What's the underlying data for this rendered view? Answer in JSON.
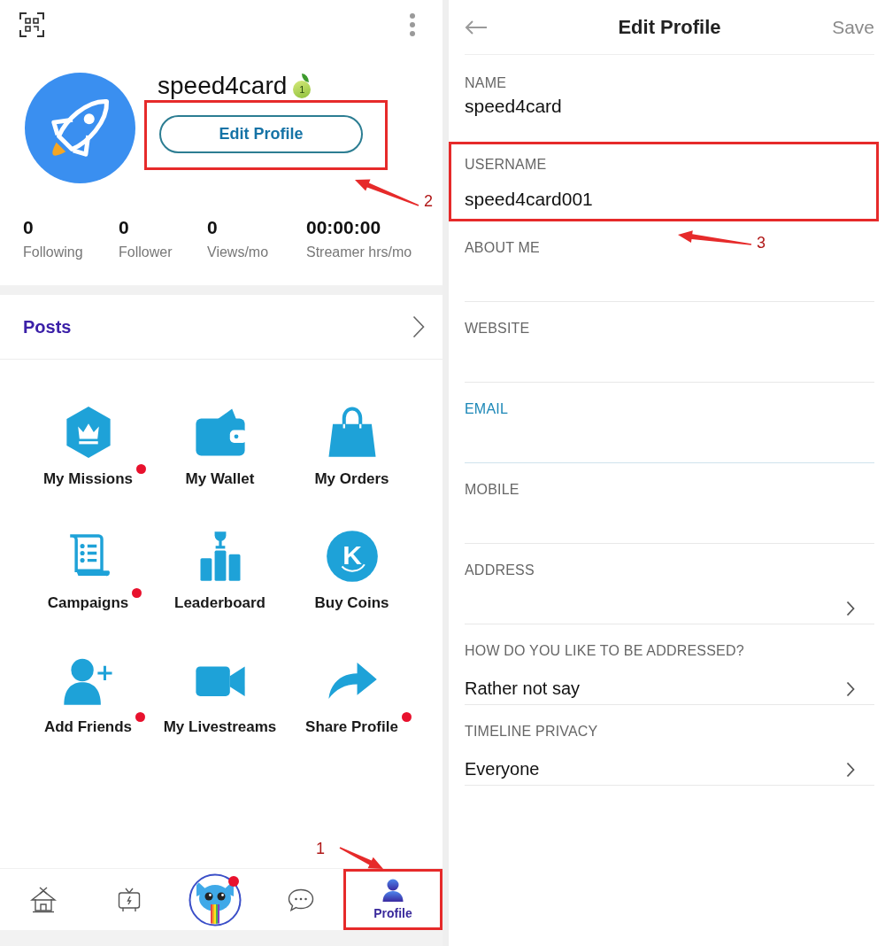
{
  "profile": {
    "username": "speed4card",
    "level_badge": "1",
    "edit_button": {
      "label": "Edit Profile",
      "callout": "2"
    }
  },
  "stats": [
    {
      "value": "0",
      "label": "Following"
    },
    {
      "value": "0",
      "label": "Follower"
    },
    {
      "value": "0",
      "label": "Views/mo"
    },
    {
      "value": "00:00:00",
      "label": "Streamer hrs/mo"
    }
  ],
  "posts": {
    "title": "Posts"
  },
  "menu": {
    "coin_letter": "K",
    "items": [
      {
        "kind": "missions",
        "label": "My Missions",
        "notification": true
      },
      {
        "kind": "wallet",
        "label": "My Wallet",
        "notification": false
      },
      {
        "kind": "orders",
        "label": "My Orders",
        "notification": false
      },
      {
        "kind": "campaigns",
        "label": "Campaigns",
        "notification": true
      },
      {
        "kind": "leaderboard",
        "label": "Leaderboard",
        "notification": false
      },
      {
        "kind": "coins",
        "label": "Buy Coins",
        "notification": false
      },
      {
        "kind": "friends",
        "label": "Add Friends",
        "notification": true
      },
      {
        "kind": "livestreams",
        "label": "My Livestreams",
        "notification": false
      },
      {
        "kind": "share",
        "label": "Share Profile",
        "notification": true
      }
    ]
  },
  "bottom_nav": [
    {
      "kind": "home",
      "selected": false,
      "notification": false
    },
    {
      "kind": "tv",
      "selected": false,
      "notification": false
    },
    {
      "kind": "mascot",
      "selected": false,
      "notification": true
    },
    {
      "kind": "chat",
      "selected": false,
      "notification": false
    },
    {
      "kind": "profile",
      "selected": true,
      "notification": false,
      "label": "Profile",
      "callout": "1"
    }
  ],
  "edit_profile": {
    "title": "Edit Profile",
    "save": "Save",
    "fields": [
      {
        "kind": "static",
        "label": "NAME",
        "value": "speed4card",
        "focused": false
      },
      {
        "kind": "static",
        "label": "USERNAME",
        "value": "speed4card001",
        "focused": false,
        "callout": "3"
      },
      {
        "kind": "input",
        "label": "ABOUT ME",
        "focused": false
      },
      {
        "kind": "input",
        "label": "WEBSITE",
        "focused": false
      },
      {
        "kind": "input",
        "label": "EMAIL",
        "focused": true
      },
      {
        "kind": "input",
        "label": "MOBILE",
        "focused": false
      },
      {
        "kind": "select",
        "label": "ADDRESS",
        "focused": false
      },
      {
        "kind": "select",
        "label": "HOW DO YOU LIKE TO BE ADDRESSED?",
        "value": "Rather not say",
        "focused": false
      },
      {
        "kind": "select",
        "label": "TIMELINE PRIVACY",
        "value": "Everyone",
        "focused": false
      }
    ]
  }
}
